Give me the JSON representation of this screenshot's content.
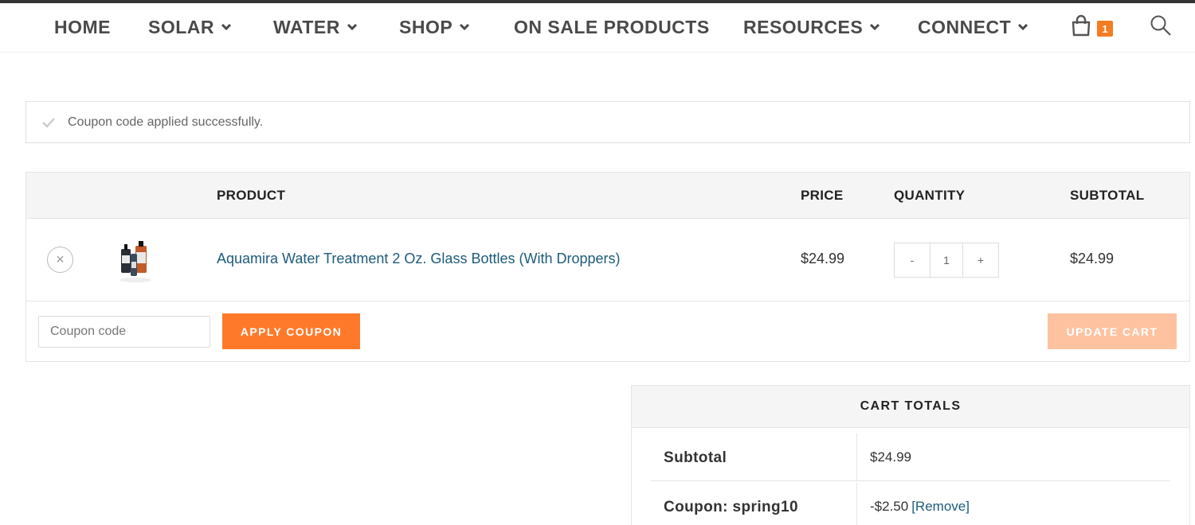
{
  "nav": {
    "items": [
      {
        "label": "HOME",
        "has_dropdown": false
      },
      {
        "label": "SOLAR",
        "has_dropdown": true
      },
      {
        "label": "WATER",
        "has_dropdown": true
      },
      {
        "label": "SHOP",
        "has_dropdown": true
      },
      {
        "label": "ON SALE PRODUCTS",
        "has_dropdown": false
      },
      {
        "label": "RESOURCES",
        "has_dropdown": true
      },
      {
        "label": "CONNECT",
        "has_dropdown": true
      }
    ],
    "cart_count": "1",
    "cart_icon": "shopping-bag-icon",
    "search_icon": "search-icon"
  },
  "notice": {
    "icon": "check-icon",
    "text": "Coupon code applied successfully."
  },
  "cart_table": {
    "headers": {
      "product": "PRODUCT",
      "price": "PRICE",
      "quantity": "QUANTITY",
      "subtotal": "SUBTOTAL"
    },
    "items": [
      {
        "name": "Aquamira Water Treatment 2 Oz. Glass Bottles (With Droppers)",
        "price": "$24.99",
        "quantity": "1",
        "subtotal": "$24.99",
        "remove_symbol": "×",
        "minus_symbol": "-",
        "plus_symbol": "+"
      }
    ],
    "coupon_placeholder": "Coupon code",
    "apply_label": "APPLY COUPON",
    "update_label": "UPDATE CART"
  },
  "totals": {
    "title": "CART TOTALS",
    "subtotal_label": "Subtotal",
    "subtotal_value": "$24.99",
    "coupon_label": "Coupon: spring10",
    "coupon_value": "-$2.50",
    "coupon_remove": "[Remove]"
  },
  "colors": {
    "accent": "#fe7a2a",
    "accent_disabled": "#fec2a0",
    "link": "#1d5b7a",
    "nav_text": "#4a4a4a"
  }
}
